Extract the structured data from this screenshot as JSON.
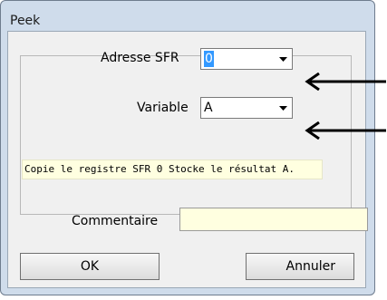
{
  "window": {
    "title": "Peek"
  },
  "form": {
    "adresse_label": "Adresse SFR",
    "adresse_value": "0",
    "variable_label": "Variable",
    "variable_value": "A",
    "info_text": "Copie le registre SFR 0 Stocke le résultat A.",
    "comment_label": "Commentaire",
    "comment_value": ""
  },
  "buttons": {
    "ok": "OK",
    "cancel": "Annuler"
  },
  "icons": {
    "dropdown": "chevron-down-icon",
    "annotation": "arrow-left-icon"
  },
  "colors": {
    "selection": "#3399ff",
    "info_background": "#ffffe0",
    "window_frame": "#cfdceb"
  }
}
